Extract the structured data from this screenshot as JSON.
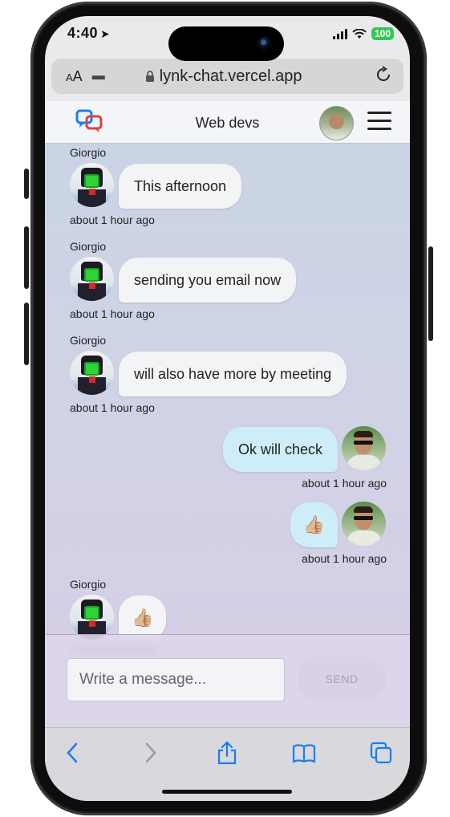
{
  "status_bar": {
    "time": "4:40",
    "battery": "100"
  },
  "browser": {
    "text_size_label": "AA",
    "url": "lynk-chat.vercel.app"
  },
  "header": {
    "room_title": "Web devs"
  },
  "messages": [
    {
      "sender": "Giorgio",
      "text": "This afternoon",
      "time": "about 1 hour ago",
      "mine": false
    },
    {
      "sender": "Giorgio",
      "text": "sending you email now",
      "time": "about 1 hour ago",
      "mine": false
    },
    {
      "sender": "Giorgio",
      "text": "will also have more by meeting",
      "time": "about 1 hour ago",
      "mine": false
    },
    {
      "sender": "",
      "text": "Ok will check",
      "time": "about 1 hour ago",
      "mine": true
    },
    {
      "sender": "",
      "text": "👍🏼",
      "time": "about 1 hour ago",
      "mine": true
    },
    {
      "sender": "Giorgio",
      "text": "👍🏼",
      "time": "",
      "mine": false
    }
  ],
  "composer": {
    "placeholder": "Write a message...",
    "send_label": "SEND"
  },
  "colors": {
    "my_bubble": "#cdeef9",
    "their_bubble": "#f3f4f6",
    "accent_blue": "#1a7cf5",
    "logo_red": "#e0413f"
  },
  "icons": [
    "location-arrow-icon",
    "signal-icon",
    "wifi-icon",
    "lock-icon",
    "extension-icon",
    "reload-icon",
    "chat-logo-icon",
    "hamburger-menu-icon",
    "back-icon",
    "forward-icon",
    "share-icon",
    "bookmarks-icon",
    "tabs-icon"
  ]
}
